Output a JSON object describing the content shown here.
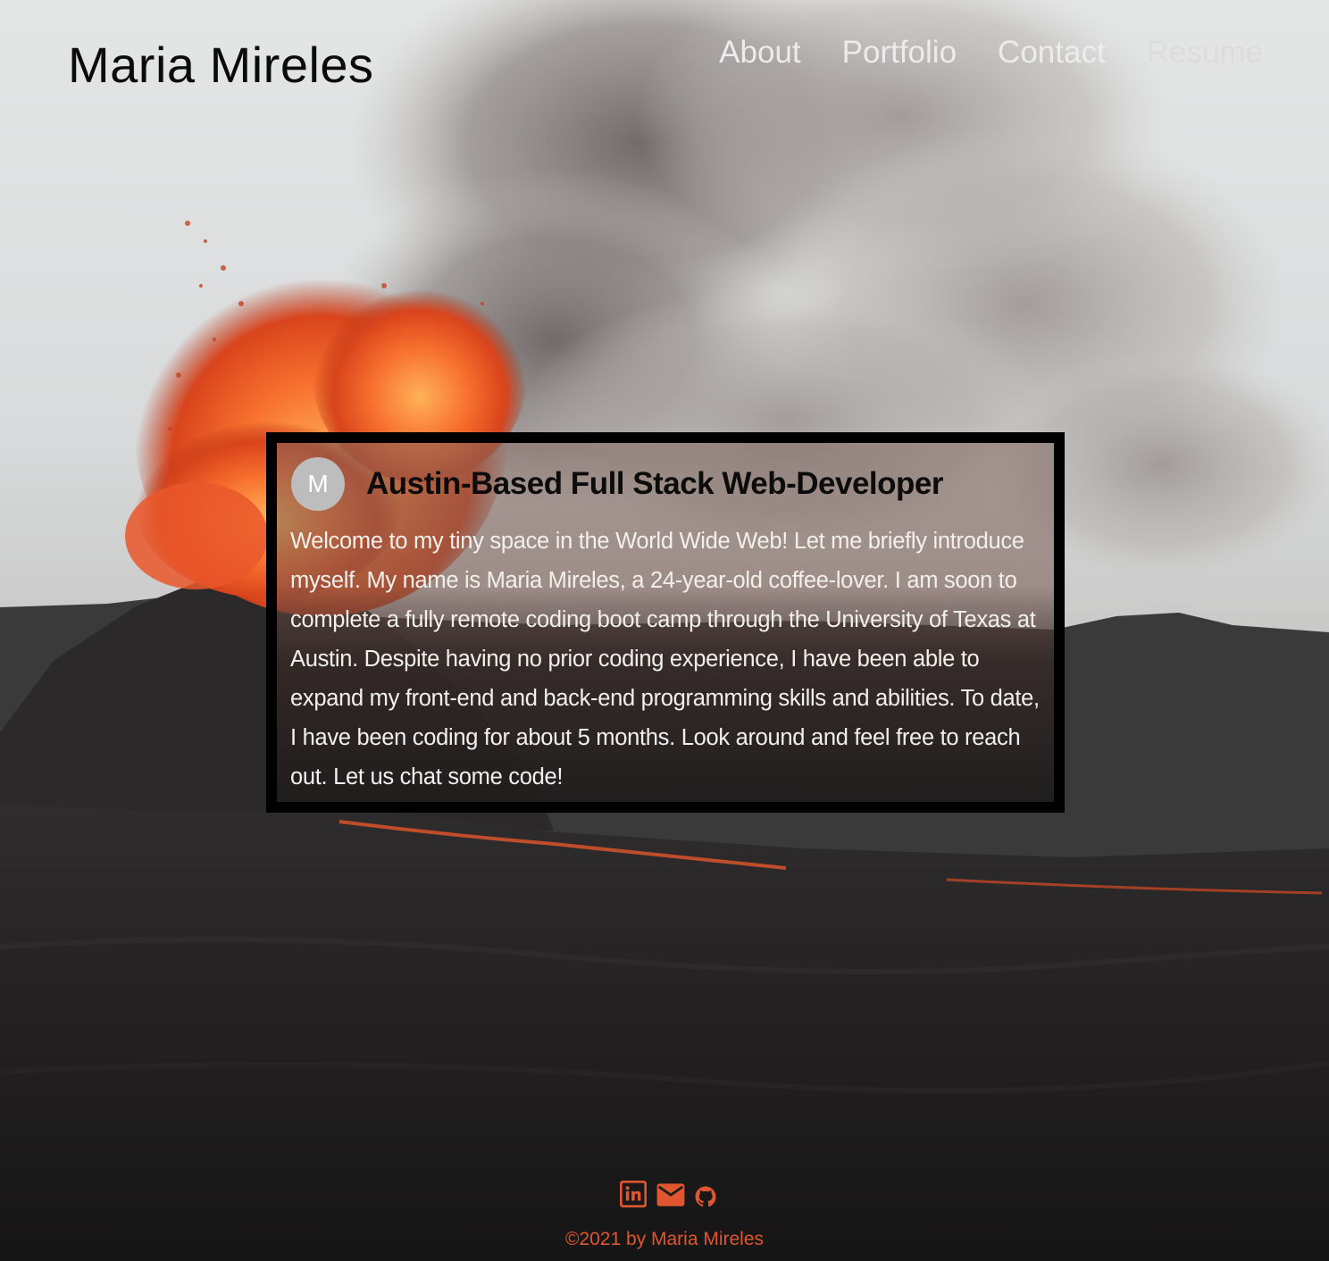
{
  "header": {
    "brand": "Maria Mireles",
    "nav": [
      {
        "label": "About"
      },
      {
        "label": "Portfolio"
      },
      {
        "label": "Contact"
      },
      {
        "label": "Resume"
      }
    ]
  },
  "intro": {
    "avatar_letter": "M",
    "title": "Austin-Based Full Stack Web-Developer",
    "body": "Welcome to my tiny space in the World Wide Web! Let me briefly introduce myself. My name is Maria Mireles, a 24-year-old coffee-lover. I am soon to complete a fully remote coding boot camp through the University of Texas at Austin. Despite having no prior coding experience, I have been able to expand my front-end and back-end programming skills and abilities. To date, I have been coding for about 5 months. Look around and feel free to reach out. Let us chat some code!"
  },
  "footer": {
    "socials": [
      {
        "icon": "linkedin-icon"
      },
      {
        "icon": "mail-icon"
      },
      {
        "icon": "github-icon"
      }
    ],
    "copyright": "©2021 by Maria Mireles"
  },
  "colors": {
    "accent": "#e0562f",
    "card_border": "#000000",
    "nav_text": "#ececec"
  }
}
